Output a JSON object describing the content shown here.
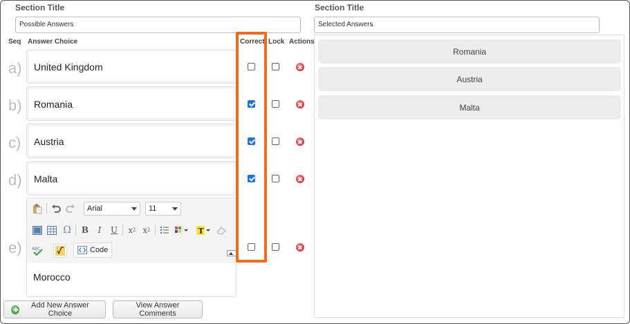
{
  "left": {
    "section_title_label": "Section Title",
    "section_title_value": "Possible Answers"
  },
  "right": {
    "section_title_label": "Section Title",
    "section_title_value": "Selected Answers"
  },
  "columns": {
    "seq": "Seq",
    "answer_choice": "Answer Choice",
    "correct": "Correct",
    "lock": "Lock",
    "actions": "Actions"
  },
  "answers": [
    {
      "seq": "a)",
      "text": "United Kingdom",
      "correct": false,
      "lock": false
    },
    {
      "seq": "b)",
      "text": "Romania",
      "correct": true,
      "lock": false
    },
    {
      "seq": "c)",
      "text": "Austria",
      "correct": true,
      "lock": false
    },
    {
      "seq": "d)",
      "text": "Malta",
      "correct": true,
      "lock": false
    },
    {
      "seq": "e)",
      "text": "Morocco",
      "correct": false,
      "lock": false
    }
  ],
  "editor": {
    "font": "Arial",
    "size": "11",
    "code_label": "Code",
    "icons": [
      "paste-icon",
      "undo-icon",
      "redo-icon",
      "image-icon",
      "table-icon",
      "omega-icon",
      "bold-icon",
      "italic-icon",
      "underline-icon",
      "subscript-icon",
      "superscript-icon",
      "bullet-list-icon",
      "color-grid-icon",
      "text-color-icon",
      "eraser-icon",
      "spellcheck-icon",
      "formula-icon",
      "code-icon"
    ]
  },
  "selected_answers": [
    "Romania",
    "Austria",
    "Malta"
  ],
  "buttons": {
    "add_new": "Add New Answer Choice",
    "view_comments": "View Answer Comments"
  },
  "colors": {
    "highlight": "#f26b1d",
    "checked": "#1a73e8",
    "delete": "#dd3333"
  }
}
